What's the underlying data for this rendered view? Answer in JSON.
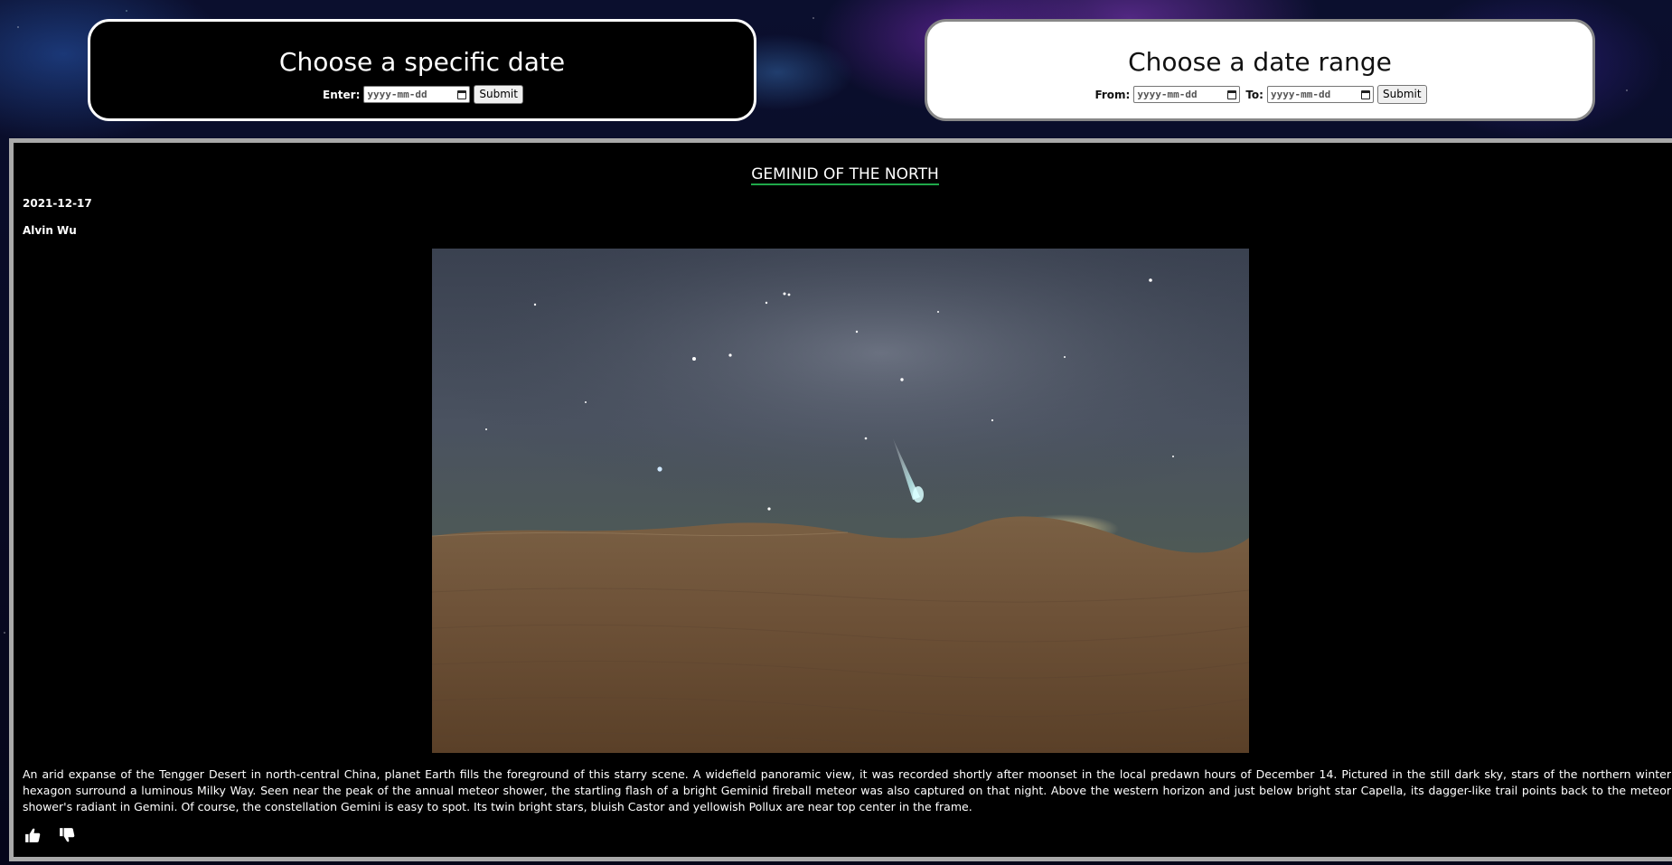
{
  "specific_date": {
    "title": "Choose a specific date",
    "enter_label": "Enter:",
    "input_placeholder": "yyyy-mm-dd",
    "submit_label": "Submit"
  },
  "date_range": {
    "title": "Choose a date range",
    "from_label": "From:",
    "from_placeholder": "yyyy-mm-dd",
    "to_label": "To:",
    "to_placeholder": "yyyy-mm-dd",
    "submit_label": "Submit"
  },
  "apod": {
    "title": "GEMINID OF THE NORTH",
    "date": "2021-12-17",
    "author": "Alvin Wu",
    "explanation": "An arid expanse of the Tengger Desert in north-central China, planet Earth fills the foreground of this starry scene. A widefield panoramic view, it was recorded shortly after moonset in the local predawn hours of December 14. Pictured in the still dark sky, stars of the northern winter hexagon surround a luminous Milky Way. Seen near the peak of the annual meteor shower, the startling flash of a bright Geminid fireball meteor was also captured on that night. Above the western horizon and just below bright star Capella, its dagger-like trail points back to the meteor shower's radiant in Gemini. Of course, the constellation Gemini is easy to spot. Its twin bright stars, bluish Castor and yellowish Pollux are near top center in the frame."
  },
  "icons": {
    "like": "thumbs-up-icon",
    "dislike": "thumbs-down-icon",
    "calendar": "calendar-icon"
  },
  "colors": {
    "title_underline": "#1fa84a",
    "panel_border": "#a9a9a9"
  }
}
